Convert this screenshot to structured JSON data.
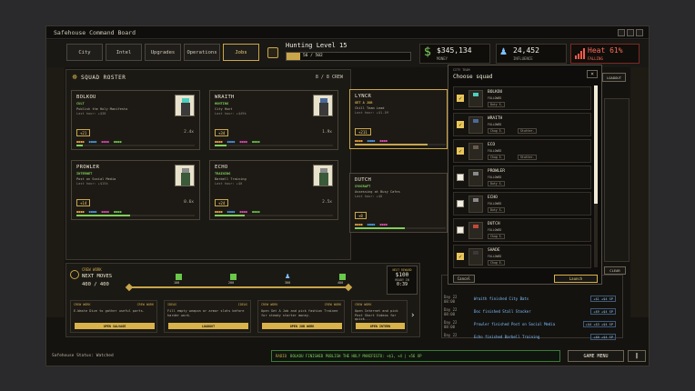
{
  "window": {
    "title": "Safehouse Command Board"
  },
  "nav": {
    "tabs": [
      "City",
      "Intel",
      "Upgrades",
      "Operations",
      "Jobs"
    ],
    "active": "Jobs"
  },
  "level": {
    "label": "Hunting Level 15",
    "xp": "56 / 502",
    "progress": 0.11
  },
  "resources": {
    "money": {
      "value": "$345,134",
      "label": "MONEY"
    },
    "influence": {
      "value": "24,452",
      "label": "INFLUENCE"
    },
    "heat": {
      "value": "Heat 61%",
      "label": "FALLING"
    }
  },
  "roster": {
    "title": "SQUAD ROSTER",
    "count": "8 / 8 CREW",
    "cards": [
      {
        "name": "BOLKOU",
        "status": "CULT",
        "job": "Publish the Holy Manifesto",
        "earn": "Last hour: +$38",
        "badge": "+21",
        "mult": "2.4x",
        "progress": 0.05
      },
      {
        "name": "WRAITH",
        "status": "HUNTING",
        "job": "City Hunt",
        "earn": "Last hour: +$49k",
        "badge": "+34",
        "mult": "1.9x",
        "progress": 0.1
      },
      {
        "name": "LYNCR",
        "status": "GET A JOB",
        "job": "Chill Team Lead",
        "earn": "Last hour: +$1.1M",
        "badge": "+211",
        "mult": "1.3x",
        "progress": 0.8
      },
      {
        "name": "PROWLER",
        "status": "INTERNET",
        "job": "Post on Social Media",
        "earn": "Last hour: +$15k",
        "badge": "+14",
        "mult": "0.6x",
        "progress": 0.45
      },
      {
        "name": "ECHO",
        "status": "TRAINING",
        "job": "Barbell Training",
        "earn": "Last hour: +$0",
        "badge": "+24",
        "mult": "2.5x",
        "progress": 0.25
      },
      {
        "name": "DUTCH",
        "status": "SYNCRAFT",
        "job": "Assessing at Busy Cafes",
        "earn": "Last hour: +$0",
        "badge": "+8",
        "mult": "",
        "progress": 0.55
      }
    ]
  },
  "crew_work": {
    "title": "CREW WORK",
    "sub": "NEXT MOVES",
    "count": "400 / 400",
    "milestones": [
      "100",
      "200",
      "300",
      "400"
    ],
    "next_reward": {
      "label": "NEXT REWARD",
      "value": "$100",
      "sub": "READY IN",
      "time": "0:39"
    },
    "tasks": [
      {
        "head": "CREW WORK",
        "head2": "CREW WORK",
        "text": "E-Waste Dive to gather useful parts.",
        "button": "OPEN SALVAGE"
      },
      {
        "head": "IDEAS",
        "head2": "IDEAS",
        "text": "Fill empty weapon or armor slots before harder work.",
        "button": "LOADOUT"
      },
      {
        "head": "CREW WORK",
        "head2": "CREW WORK",
        "text": "Open Get A Job and pick fashion Trainee for steady starter money.",
        "button": "OPEN JOB WORK"
      },
      {
        "head": "CREW WORK",
        "head2": "CREW WORK",
        "text": "Open Internet and pick Post Short Videos for quick...",
        "button": "OPEN INTERN"
      }
    ]
  },
  "dialog": {
    "header": "CITY TEAM",
    "title": "Choose squad",
    "cancel": "Cancel",
    "launch": "Launch",
    "members": [
      {
        "name": "BOLKOU",
        "status": "FOLLOWED",
        "tags": [
          "Duty S."
        ],
        "checked": true
      },
      {
        "name": "WRAITH",
        "status": "FOLLOWED",
        "tags": [
          "Chug 5.",
          "Stutter."
        ],
        "checked": true
      },
      {
        "name": "ECO",
        "status": "FOLLOWED",
        "tags": [
          "Chug 5.",
          "Stutter."
        ],
        "checked": true
      },
      {
        "name": "PROWLER",
        "status": "FOLLOWED",
        "tags": [
          "Duty S."
        ],
        "checked": false
      },
      {
        "name": "ECHO",
        "status": "FOLLOWED",
        "tags": [
          "Duty S."
        ],
        "checked": false
      },
      {
        "name": "DUTCH",
        "status": "FOLLOWED",
        "tags": [
          "Chug 5."
        ],
        "checked": false
      },
      {
        "name": "SHADE",
        "status": "FOLLOWED",
        "tags": [
          "Chug 5."
        ],
        "checked": true
      }
    ]
  },
  "right_panel": {
    "loadout": "LOADOUT",
    "clear": "CLEAR",
    "manifesto": "MANIFESTO"
  },
  "events": [
    {
      "day": "Day 22",
      "time": "08:00",
      "text": "Wraith finished City Bats",
      "badge": "+$1 +$4 SP"
    },
    {
      "day": "Day 22",
      "time": "08:00",
      "text": "Doc finished Stall Stocker",
      "badge": "+$9 +$4 SP"
    },
    {
      "day": "Day 22",
      "time": "08:00",
      "text": "Prowler finished Post on Social Media",
      "badge": "+$4 +$3 +$4 SP"
    },
    {
      "day": "Day 22",
      "time": "08:00",
      "text": "Echo finished Barbell Training",
      "badge": "+$0 +$4 SP"
    }
  ],
  "status": {
    "label": "Safehouse Status: Watched"
  },
  "ticker": {
    "tag": "RADIO",
    "text": "BOLKOU FINISHED PUBLISH THE HOLY MANIFESTO: +$1, +4 | +56 XP"
  },
  "game_menu": {
    "label": "GAME MENU"
  },
  "colors": {
    "accent": "#c9a64a",
    "money": "#7fcf5a",
    "influence": "#7ec0ff",
    "heat": "#ff5a4a"
  }
}
